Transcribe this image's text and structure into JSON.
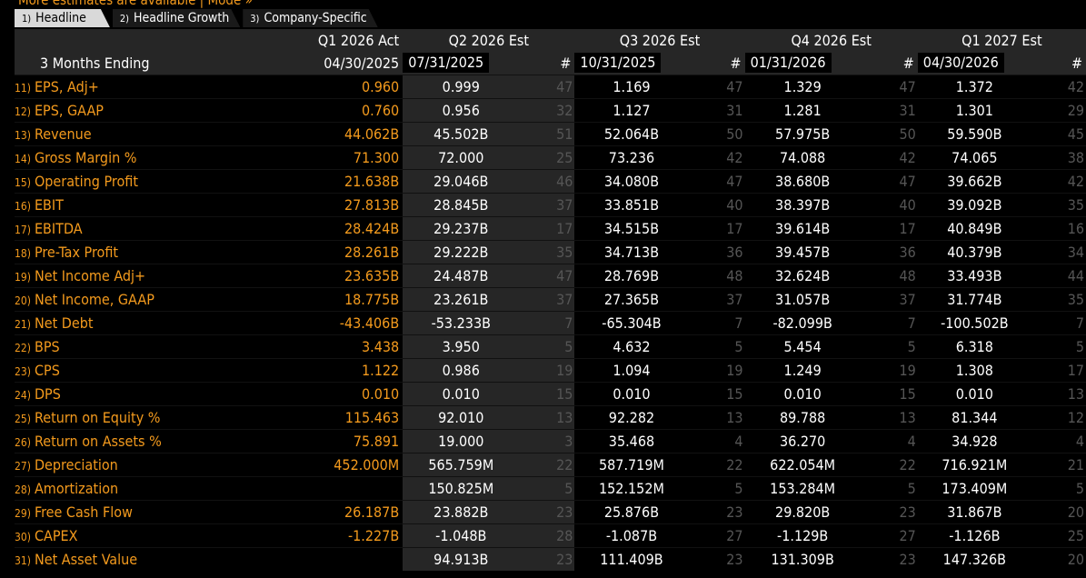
{
  "top_banner": "More estimates are available | Mode »",
  "tabs": [
    {
      "num": "1)",
      "label": "Headline"
    },
    {
      "num": "2)",
      "label": "Headline Growth"
    },
    {
      "num": "3)",
      "label": "Company-Specific"
    }
  ],
  "header": {
    "periods": [
      "Q1 2026 Act",
      "Q2 2026 Est",
      "Q3 2026 Est",
      "Q4 2026 Est",
      "Q1 2027 Est"
    ],
    "row_label": "3 Months Ending",
    "dates": [
      "04/30/2025",
      "07/31/2025",
      "10/31/2025",
      "01/31/2026",
      "04/30/2026"
    ],
    "count_symbol": "#"
  },
  "rows": [
    {
      "n": "11)",
      "label": "EPS, Adj+",
      "act": "0.960",
      "q2": "0.999",
      "c2": "47",
      "q3": "1.169",
      "c3": "47",
      "q4": "1.329",
      "c4": "47",
      "q5": "1.372",
      "c5": "42"
    },
    {
      "n": "12)",
      "label": "EPS, GAAP",
      "act": "0.760",
      "q2": "0.956",
      "c2": "32",
      "q3": "1.127",
      "c3": "31",
      "q4": "1.281",
      "c4": "31",
      "q5": "1.301",
      "c5": "29"
    },
    {
      "n": "13)",
      "label": "Revenue",
      "act": "44.062B",
      "q2": "45.502B",
      "c2": "51",
      "q3": "52.064B",
      "c3": "50",
      "q4": "57.975B",
      "c4": "50",
      "q5": "59.590B",
      "c5": "45"
    },
    {
      "n": "14)",
      "label": "Gross Margin %",
      "act": "71.300",
      "q2": "72.000",
      "c2": "25",
      "q3": "73.236",
      "c3": "42",
      "q4": "74.088",
      "c4": "42",
      "q5": "74.065",
      "c5": "38"
    },
    {
      "n": "15)",
      "label": "Operating Profit",
      "act": "21.638B",
      "q2": "29.046B",
      "c2": "46",
      "q3": "34.080B",
      "c3": "47",
      "q4": "38.680B",
      "c4": "47",
      "q5": "39.662B",
      "c5": "42"
    },
    {
      "n": "16)",
      "label": "EBIT",
      "act": "27.813B",
      "q2": "28.845B",
      "c2": "37",
      "q3": "33.851B",
      "c3": "40",
      "q4": "38.397B",
      "c4": "40",
      "q5": "39.092B",
      "c5": "35"
    },
    {
      "n": "17)",
      "label": "EBITDA",
      "act": "28.424B",
      "q2": "29.237B",
      "c2": "17",
      "q3": "34.515B",
      "c3": "17",
      "q4": "39.614B",
      "c4": "17",
      "q5": "40.849B",
      "c5": "16"
    },
    {
      "n": "18)",
      "label": "Pre-Tax Profit",
      "act": "28.261B",
      "q2": "29.222B",
      "c2": "35",
      "q3": "34.713B",
      "c3": "36",
      "q4": "39.457B",
      "c4": "36",
      "q5": "40.379B",
      "c5": "34"
    },
    {
      "n": "19)",
      "label": "Net Income Adj+",
      "act": "23.635B",
      "q2": "24.487B",
      "c2": "47",
      "q3": "28.769B",
      "c3": "48",
      "q4": "32.624B",
      "c4": "48",
      "q5": "33.493B",
      "c5": "44"
    },
    {
      "n": "20)",
      "label": "Net Income, GAAP",
      "act": "18.775B",
      "q2": "23.261B",
      "c2": "37",
      "q3": "27.365B",
      "c3": "37",
      "q4": "31.057B",
      "c4": "37",
      "q5": "31.774B",
      "c5": "35"
    },
    {
      "n": "21)",
      "label": "Net Debt",
      "act": "-43.406B",
      "q2": "-53.233B",
      "c2": "7",
      "q3": "-65.304B",
      "c3": "7",
      "q4": "-82.099B",
      "c4": "7",
      "q5": "-100.502B",
      "c5": "7"
    },
    {
      "n": "22)",
      "label": "BPS",
      "act": "3.438",
      "q2": "3.950",
      "c2": "5",
      "q3": "4.632",
      "c3": "5",
      "q4": "5.454",
      "c4": "5",
      "q5": "6.318",
      "c5": "5"
    },
    {
      "n": "23)",
      "label": "CPS",
      "act": "1.122",
      "q2": "0.986",
      "c2": "19",
      "q3": "1.094",
      "c3": "19",
      "q4": "1.249",
      "c4": "19",
      "q5": "1.308",
      "c5": "17"
    },
    {
      "n": "24)",
      "label": "DPS",
      "act": "0.010",
      "q2": "0.010",
      "c2": "15",
      "q3": "0.010",
      "c3": "15",
      "q4": "0.010",
      "c4": "15",
      "q5": "0.010",
      "c5": "13"
    },
    {
      "n": "25)",
      "label": "Return on Equity %",
      "act": "115.463",
      "q2": "92.010",
      "c2": "13",
      "q3": "92.282",
      "c3": "13",
      "q4": "89.788",
      "c4": "13",
      "q5": "81.344",
      "c5": "12"
    },
    {
      "n": "26)",
      "label": "Return on Assets %",
      "act": "75.891",
      "q2": "19.000",
      "c2": "3",
      "q3": "35.468",
      "c3": "4",
      "q4": "36.270",
      "c4": "4",
      "q5": "34.928",
      "c5": "4"
    },
    {
      "n": "27)",
      "label": "Depreciation",
      "act": "452.000M",
      "q2": "565.759M",
      "c2": "22",
      "q3": "587.719M",
      "c3": "22",
      "q4": "622.054M",
      "c4": "22",
      "q5": "716.921M",
      "c5": "21"
    },
    {
      "n": "28)",
      "label": "Amortization",
      "act": "",
      "q2": "150.825M",
      "c2": "5",
      "q3": "152.152M",
      "c3": "5",
      "q4": "153.284M",
      "c4": "5",
      "q5": "173.409M",
      "c5": "5"
    },
    {
      "n": "29)",
      "label": "Free Cash Flow",
      "act": "26.187B",
      "q2": "23.882B",
      "c2": "23",
      "q3": "25.876B",
      "c3": "23",
      "q4": "29.820B",
      "c4": "23",
      "q5": "31.867B",
      "c5": "20"
    },
    {
      "n": "30)",
      "label": "CAPEX",
      "act": "-1.227B",
      "q2": "-1.048B",
      "c2": "28",
      "q3": "-1.087B",
      "c3": "27",
      "q4": "-1.129B",
      "c4": "27",
      "q5": "-1.126B",
      "c5": "25"
    },
    {
      "n": "31)",
      "label": "Net Asset Value",
      "act": "",
      "q2": "94.913B",
      "c2": "23",
      "q3": "111.409B",
      "c3": "23",
      "q4": "131.309B",
      "c4": "23",
      "q5": "147.326B",
      "c5": "20"
    }
  ]
}
